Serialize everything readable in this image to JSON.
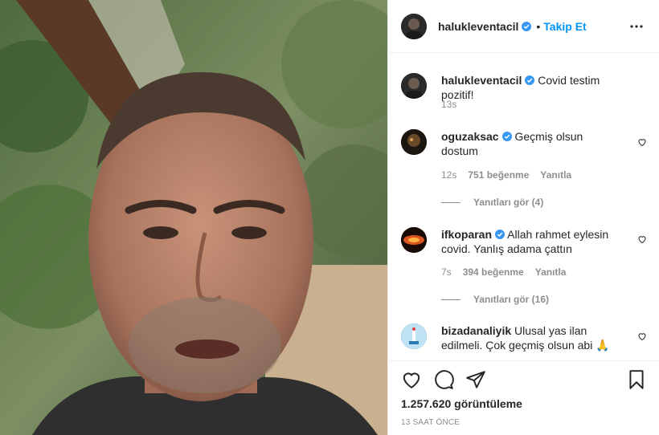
{
  "post": {
    "username": "halukleventacil",
    "follow_label": "Takip Et",
    "separator": "•"
  },
  "caption": {
    "username": "halukleventacil",
    "text": "Covid testim pozitif!",
    "time": "13s"
  },
  "comments": [
    {
      "username": "oguzaksac",
      "text": "Geçmiş olsun dostum",
      "time": "12s",
      "likes": "751 beğenme",
      "reply_label": "Yanıtla",
      "view_replies": "Yanıtları gör (4)"
    },
    {
      "username": "ifkoparan",
      "text": "Allah rahmet eylesin covid. Yanlış adama çattın",
      "time": "7s",
      "likes": "394 beğenme",
      "reply_label": "Yanıtla",
      "view_replies": "Yanıtları gör (16)"
    },
    {
      "username": "bizadanaliyik",
      "text": "Ulusal yas ilan edilmeli. Çok geçmiş olsun abi 🙏",
      "time": "",
      "likes": "",
      "reply_label": "",
      "view_replies": ""
    }
  ],
  "footer": {
    "views": "1.257.620 görüntüleme",
    "timestamp": "13 SAAT ÖNCE"
  },
  "icons": {
    "verified": "verified-badge-icon",
    "more": "more-options-icon",
    "like": "heart-icon",
    "comment": "comment-icon",
    "share": "share-icon",
    "save": "bookmark-icon"
  },
  "colors": {
    "accent": "#0095f6",
    "text": "#262626",
    "muted": "#8e8e8e",
    "border": "#efefef"
  }
}
